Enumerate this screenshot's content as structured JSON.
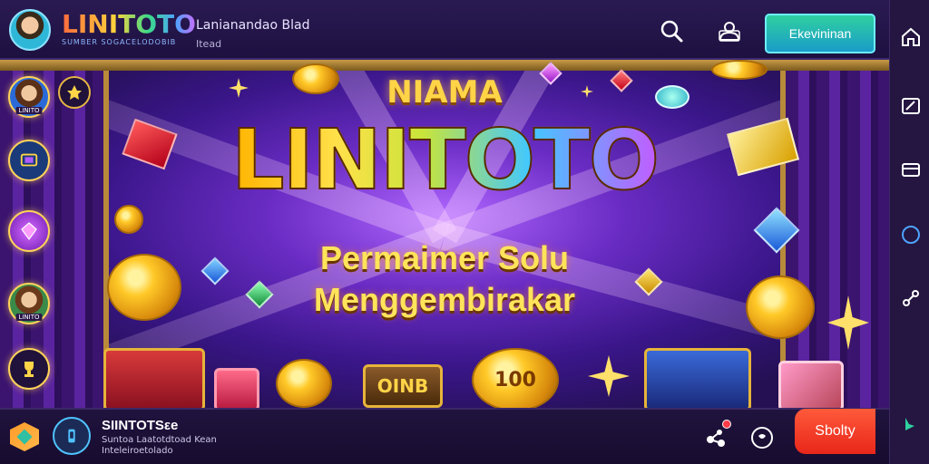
{
  "header": {
    "logo_text": "LINITOTO",
    "logo_tagline": "SUMBER SOGACELODOBIB",
    "title": "Lanianandao Blad",
    "subtitle": "Itead",
    "cta_label": "Ekevininan"
  },
  "banner": {
    "eyebrow": "NIAMA",
    "brand": "LINITOTO",
    "headline_line1": "Permaimer Solu",
    "headline_line2": "Menggembirakar",
    "chest_label": "OINB",
    "coin_label": "100"
  },
  "sidebar": {
    "avatars": [
      {
        "label": "LINITO",
        "icon": "player-avatar"
      },
      {
        "label": "",
        "icon": "tv-icon"
      },
      {
        "label": "",
        "icon": "gem-icon"
      },
      {
        "label": "LINITO",
        "icon": "player-avatar"
      },
      {
        "label": "",
        "icon": "trophy-icon"
      }
    ]
  },
  "footer": {
    "title": "SIINTOTSεe",
    "line1": "Suntoa Laatotdtoad Kean",
    "line2": "Inteleiroetolado",
    "play_label": "Sbolty"
  },
  "icons": {
    "header": [
      "search-icon",
      "user-icon"
    ],
    "rail": [
      "home-icon",
      "edit-icon",
      "wallet-icon",
      "circle-icon",
      "link-icon",
      "brand-icon"
    ],
    "footer": [
      "share-icon",
      "chat-icon"
    ]
  },
  "colors": {
    "accent": "#2fd0a0",
    "play": "#e8261a",
    "gold": "#ffd447",
    "background": "#1a0f33"
  }
}
